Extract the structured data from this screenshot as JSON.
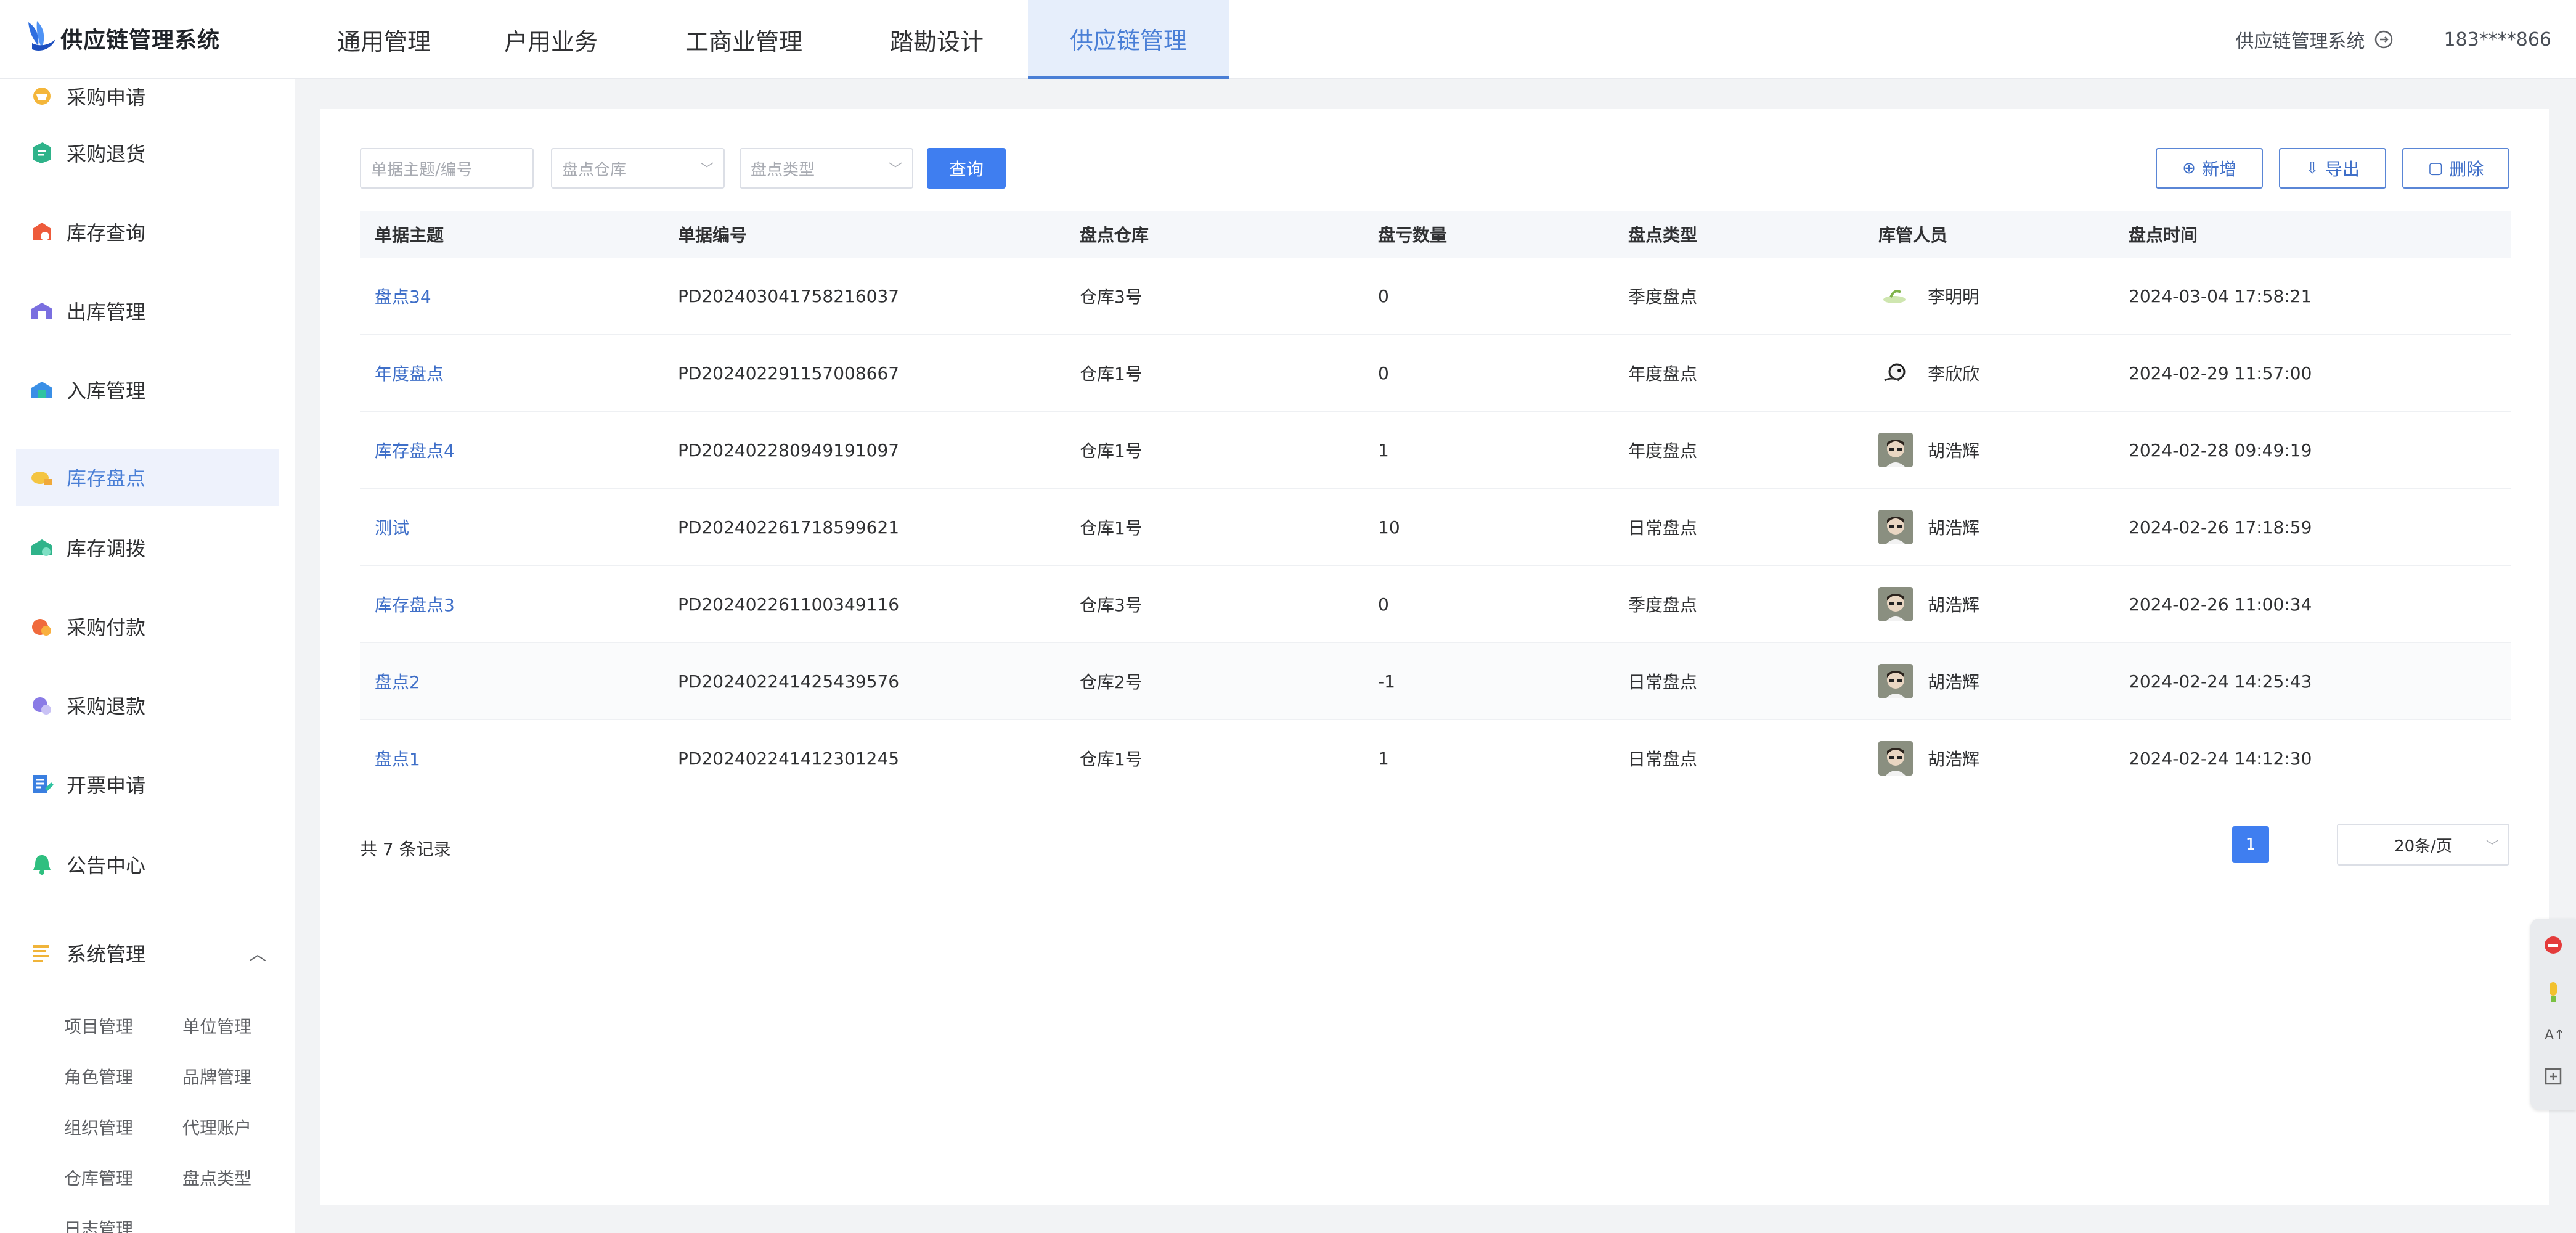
{
  "app": {
    "title": "供应链管理系统"
  },
  "nav": {
    "items": [
      {
        "label": "通用管理"
      },
      {
        "label": "户用业务"
      },
      {
        "label": "工商业管理"
      },
      {
        "label": "踏勘设计"
      },
      {
        "label": "供应链管理",
        "active": true
      }
    ]
  },
  "header": {
    "system_name": "供应链管理系统",
    "user": "183****866"
  },
  "sidebar": {
    "items": [
      {
        "label": "采购申请",
        "icon": "cart-icon"
      },
      {
        "label": "采购退货",
        "icon": "return-icon"
      },
      {
        "label": "库存查询",
        "icon": "search-stock-icon"
      },
      {
        "label": "出库管理",
        "icon": "outbound-icon"
      },
      {
        "label": "入库管理",
        "icon": "inbound-icon"
      },
      {
        "label": "库存盘点",
        "icon": "inventory-check-icon",
        "active": true
      },
      {
        "label": "库存调拨",
        "icon": "transfer-icon"
      },
      {
        "label": "采购付款",
        "icon": "payment-icon"
      },
      {
        "label": "采购退款",
        "icon": "refund-icon"
      },
      {
        "label": "开票申请",
        "icon": "invoice-icon"
      },
      {
        "label": "公告中心",
        "icon": "bell-icon"
      }
    ],
    "group": {
      "label": "系统管理",
      "icon": "system-icon",
      "expanded": true
    },
    "sub_items": [
      "项目管理",
      "单位管理",
      "角色管理",
      "品牌管理",
      "组织管理",
      "代理账户",
      "仓库管理",
      "盘点类型",
      "日志管理"
    ]
  },
  "filters": {
    "keyword_placeholder": "单据主题/编号",
    "warehouse_placeholder": "盘点仓库",
    "type_placeholder": "盘点类型",
    "query_label": "查询"
  },
  "actions": {
    "add": "新增",
    "export": "导出",
    "delete": "删除"
  },
  "table": {
    "columns": [
      "单据主题",
      "单据编号",
      "盘点仓库",
      "盘亏数量",
      "盘点类型",
      "库管人员",
      "盘点时间"
    ],
    "rows": [
      {
        "subject": "盘点34",
        "code": "PD202403041758216037",
        "warehouse": "仓库3号",
        "qty": "0",
        "type": "季度盘点",
        "keeper": "李明明",
        "time": "2024-03-04 17:58:21",
        "avatar": "plant"
      },
      {
        "subject": "年度盘点",
        "code": "PD202402291157008667",
        "warehouse": "仓库1号",
        "qty": "0",
        "type": "年度盘点",
        "keeper": "李欣欣",
        "time": "2024-02-29 11:57:00",
        "avatar": "bird"
      },
      {
        "subject": "库存盘点4",
        "code": "PD202402280949191097",
        "warehouse": "仓库1号",
        "qty": "1",
        "type": "年度盘点",
        "keeper": "胡浩辉",
        "time": "2024-02-28 09:49:19",
        "avatar": "person"
      },
      {
        "subject": "测试",
        "code": "PD202402261718599621",
        "warehouse": "仓库1号",
        "qty": "10",
        "type": "日常盘点",
        "keeper": "胡浩辉",
        "time": "2024-02-26 17:18:59",
        "avatar": "person"
      },
      {
        "subject": "库存盘点3",
        "code": "PD202402261100349116",
        "warehouse": "仓库3号",
        "qty": "0",
        "type": "季度盘点",
        "keeper": "胡浩辉",
        "time": "2024-02-26 11:00:34",
        "avatar": "person"
      },
      {
        "subject": "盘点2",
        "code": "PD202402241425439576",
        "warehouse": "仓库2号",
        "qty": "-1",
        "type": "日常盘点",
        "keeper": "胡浩辉",
        "time": "2024-02-24 14:25:43",
        "avatar": "person"
      },
      {
        "subject": "盘点1",
        "code": "PD202402241412301245",
        "warehouse": "仓库1号",
        "qty": "1",
        "type": "日常盘点",
        "keeper": "胡浩辉",
        "time": "2024-02-24 14:12:30",
        "avatar": "person"
      }
    ]
  },
  "pagination": {
    "total_text": "共 7 条记录",
    "current_page": "1",
    "page_size": "20条/页"
  },
  "colors": {
    "primary": "#3f7ef0",
    "link": "#3f6fc8",
    "nav_active_bg": "#e6eefb"
  }
}
